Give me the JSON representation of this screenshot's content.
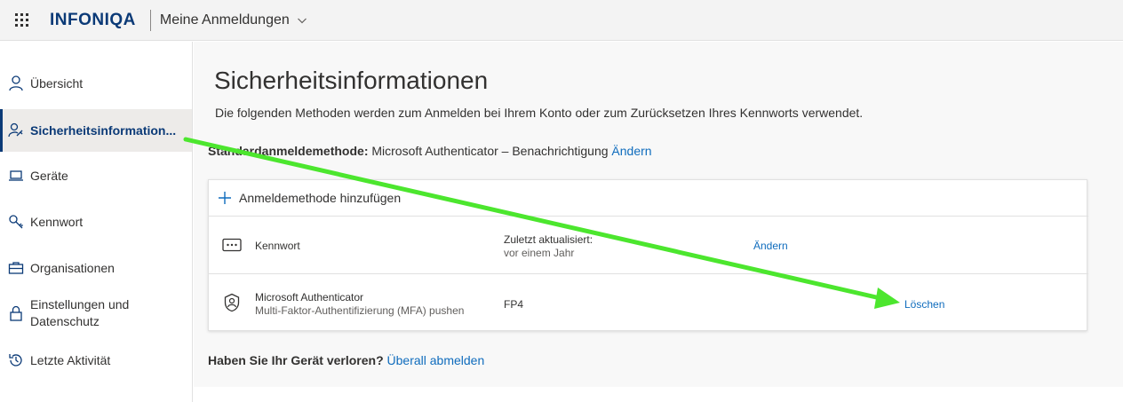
{
  "header": {
    "logo": "INFONIQA",
    "app_title": "Meine Anmeldungen",
    "icons": {
      "waffle": "app-launcher-icon",
      "chevron": "chevron-down-icon"
    }
  },
  "sidebar": {
    "items": [
      {
        "label": "Übersicht",
        "icon": "person-icon"
      },
      {
        "label": "Sicherheitsinformation...",
        "icon": "person-key-icon",
        "active": true
      },
      {
        "label": "Geräte",
        "icon": "laptop-icon"
      },
      {
        "label": "Kennwort",
        "icon": "key-icon"
      },
      {
        "label": "Organisationen",
        "icon": "briefcase-icon"
      },
      {
        "label": "Einstellungen und Datenschutz",
        "icon": "lock-icon"
      },
      {
        "label": "Letzte Aktivität",
        "icon": "history-icon"
      }
    ]
  },
  "main": {
    "title": "Sicherheitsinformationen",
    "description": "Die folgenden Methoden werden zum Anmelden bei Ihrem Konto oder zum Zurücksetzen Ihres Kennworts verwendet.",
    "default_method": {
      "label": "Standardanmeldemethode:",
      "value": "Microsoft Authenticator – Benachrichtigung",
      "change_link": "Ändern"
    },
    "add_method_label": "Anmeldemethode hinzufügen",
    "methods": [
      {
        "name": "Kennwort",
        "subtitle": "",
        "detail_label": "Zuletzt aktualisiert:",
        "detail_value": "vor einem Jahr",
        "action": "Ändern",
        "icon": "password-dots-icon"
      },
      {
        "name": "Microsoft Authenticator",
        "subtitle": "Multi-Faktor-Authentifizierung (MFA) pushen",
        "detail_label": "FP4",
        "detail_value": "",
        "action": "Löschen",
        "icon": "authenticator-icon"
      }
    ],
    "lost_device": {
      "question": "Haben Sie Ihr Gerät verloren?",
      "link": "Überall abmelden"
    }
  },
  "annotation": {
    "arrow_color": "#4ce62e"
  },
  "colors": {
    "accent": "#0b3a77",
    "link": "#0f6cbd",
    "active_bg": "#edebe9"
  }
}
